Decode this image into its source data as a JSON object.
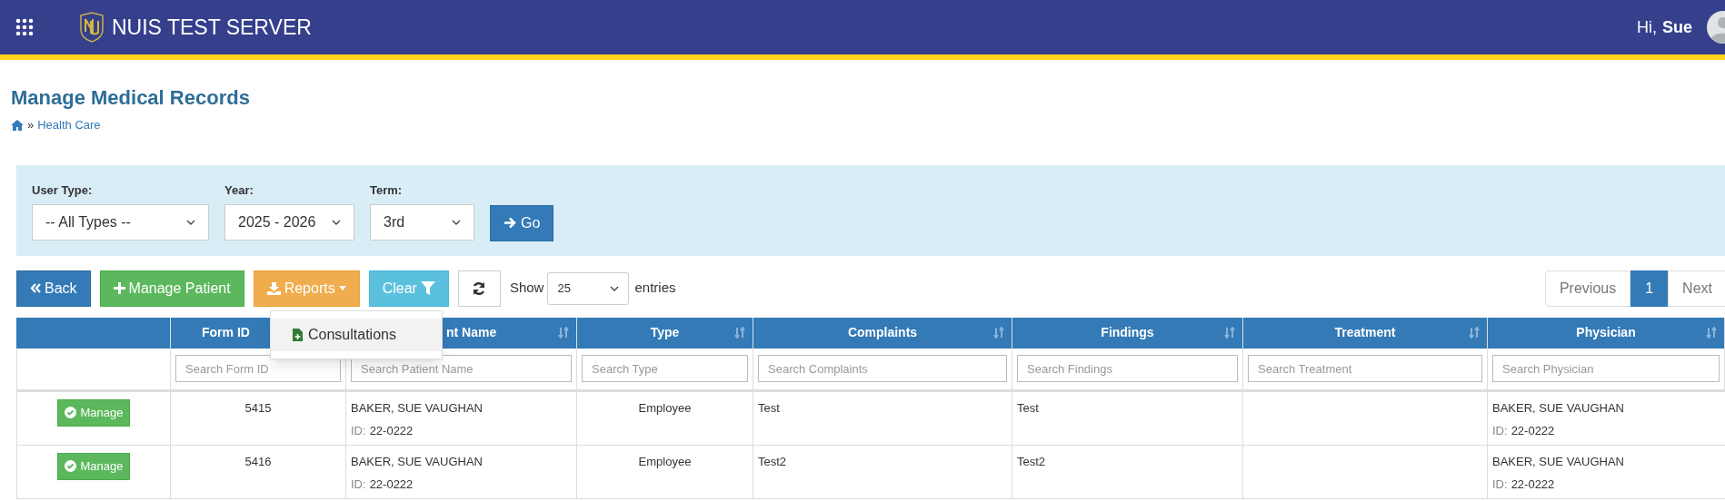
{
  "header": {
    "title": "NUIS TEST SERVER",
    "greeting": "Hi,",
    "user": "Sue"
  },
  "page_title": "Manage Medical Records",
  "breadcrumb": {
    "separator": "»",
    "items": [
      {
        "label": "Health Care"
      }
    ]
  },
  "filters": [
    {
      "label": "User Type:",
      "value": "-- All Types --"
    },
    {
      "label": "Year:",
      "value": "2025 - 2026"
    },
    {
      "label": "Term:",
      "value": "3rd"
    }
  ],
  "go_button": "Go",
  "toolbar": {
    "back": "Back",
    "manage_patient": "Manage Patient",
    "reports": "Reports",
    "clear": "Clear",
    "show_label": "Show",
    "page_size": "25",
    "entries_label": "entries"
  },
  "reports_menu": [
    {
      "label": "Consultations",
      "selected": true
    }
  ],
  "pagination": [
    {
      "label": "Previous",
      "selected": false
    },
    {
      "label": "1",
      "selected": true
    },
    {
      "label": "Next",
      "selected": false
    }
  ],
  "table": {
    "columns": [
      {},
      {
        "label": "Form ID",
        "search_placeholder": "Search Form ID"
      },
      {
        "label": "nt Name",
        "sort_icon": true,
        "search_placeholder": "Search Patient Name"
      },
      {
        "label": "Type",
        "sort_icon": true,
        "search_placeholder": "Search Type"
      },
      {
        "label": "Complaints",
        "sort_icon": true,
        "search_placeholder": "Search Complaints"
      },
      {
        "label": "Findings",
        "sort_icon": true,
        "search_placeholder": "Search Findings"
      },
      {
        "label": "Treatment",
        "sort_icon": true,
        "search_placeholder": "Search Treatment"
      },
      {
        "label": "Physician",
        "sort_icon": true,
        "search_placeholder": "Search Physician"
      }
    ],
    "rows": [
      {
        "action": "Manage",
        "form_id": "5415",
        "patient": {
          "name": "BAKER, SUE VAUGHAN",
          "id_label": "ID:",
          "id": "22-0222"
        },
        "type": "Employee",
        "complaints": "Test",
        "findings": "Test",
        "physician": {
          "name": "BAKER, SUE VAUGHAN",
          "id_label": "ID:",
          "id": "22-0222"
        }
      },
      {
        "action": "Manage",
        "form_id": "5416",
        "patient": {
          "name": "BAKER, SUE VAUGHAN",
          "id_label": "ID:",
          "id": "22-0222"
        },
        "type": "Employee",
        "complaints": "Test2",
        "findings": "Test2",
        "physician": {
          "name": "BAKER, SUE VAUGHAN",
          "id_label": "ID:",
          "id": "22-0222"
        }
      }
    ]
  }
}
